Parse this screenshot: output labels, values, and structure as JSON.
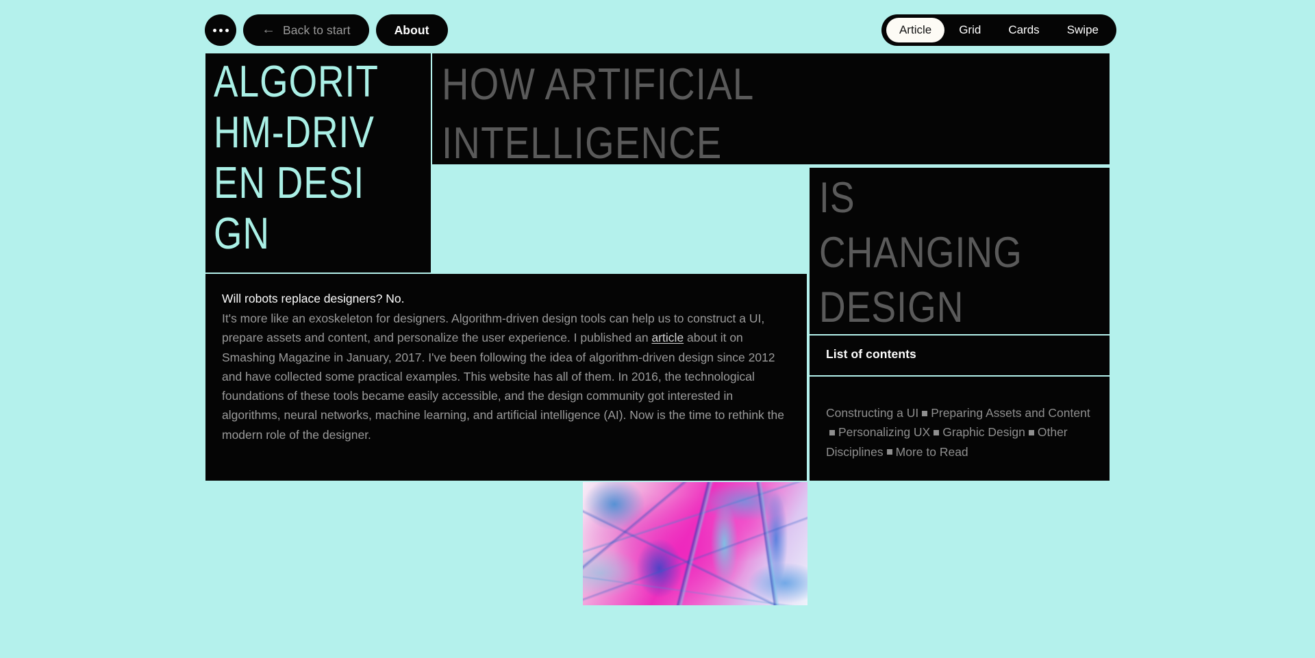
{
  "theme": {
    "background": "#b4f1ec",
    "panel": "#050505",
    "accent": "#aaf0e6",
    "muted_text": "#9b9b9b",
    "heading_muted": "#5a5a5a"
  },
  "topbar": {
    "menu_button": "…",
    "back_button": {
      "icon": "arrow-left-icon",
      "label": "Back to start"
    },
    "about_button": "About",
    "view_switcher": {
      "options": [
        "Article",
        "Grid",
        "Cards",
        "Swipe"
      ],
      "selected": "Article"
    }
  },
  "hero": {
    "title": "ALGORITHM-DRIVEN DESIGN",
    "subtitle_line1": "HOW ARTIFICIAL",
    "subtitle_line2": "INTELLIGENCE",
    "subtitle_line3": "IS",
    "subtitle_line4": "CHANGING",
    "subtitle_line5": "DESIGN"
  },
  "article": {
    "lede": "Will robots replace designers? No.",
    "body_before_link": "It's more like an exoskeleton for designers. Algorithm-driven design tools can help us to construct a UI, prepare assets and content, and personalize the user experience. I published an ",
    "link_text": "article",
    "body_after_link": " about it on Smashing Magazine in January, 2017. I've been following the idea of algorithm-driven design since 2012 and have collected some practical examples. This website has all of them. In 2016, the technological foundations of these tools became easily accessible, and the design community got interested in algorithms, neural networks, machine learning, and artificial intelligence (AI). Now is the time to rethink the modern role of the designer."
  },
  "contents": {
    "heading": "List of contents",
    "items": [
      "Constructing a UI",
      "Preparing Assets and Content",
      "Personalizing UX",
      "Graphic Design",
      "Other Disciplines",
      "More to Read"
    ],
    "separator": "square-bullet"
  },
  "media": {
    "alt": "abstract-magenta-blue-organic-texture"
  }
}
